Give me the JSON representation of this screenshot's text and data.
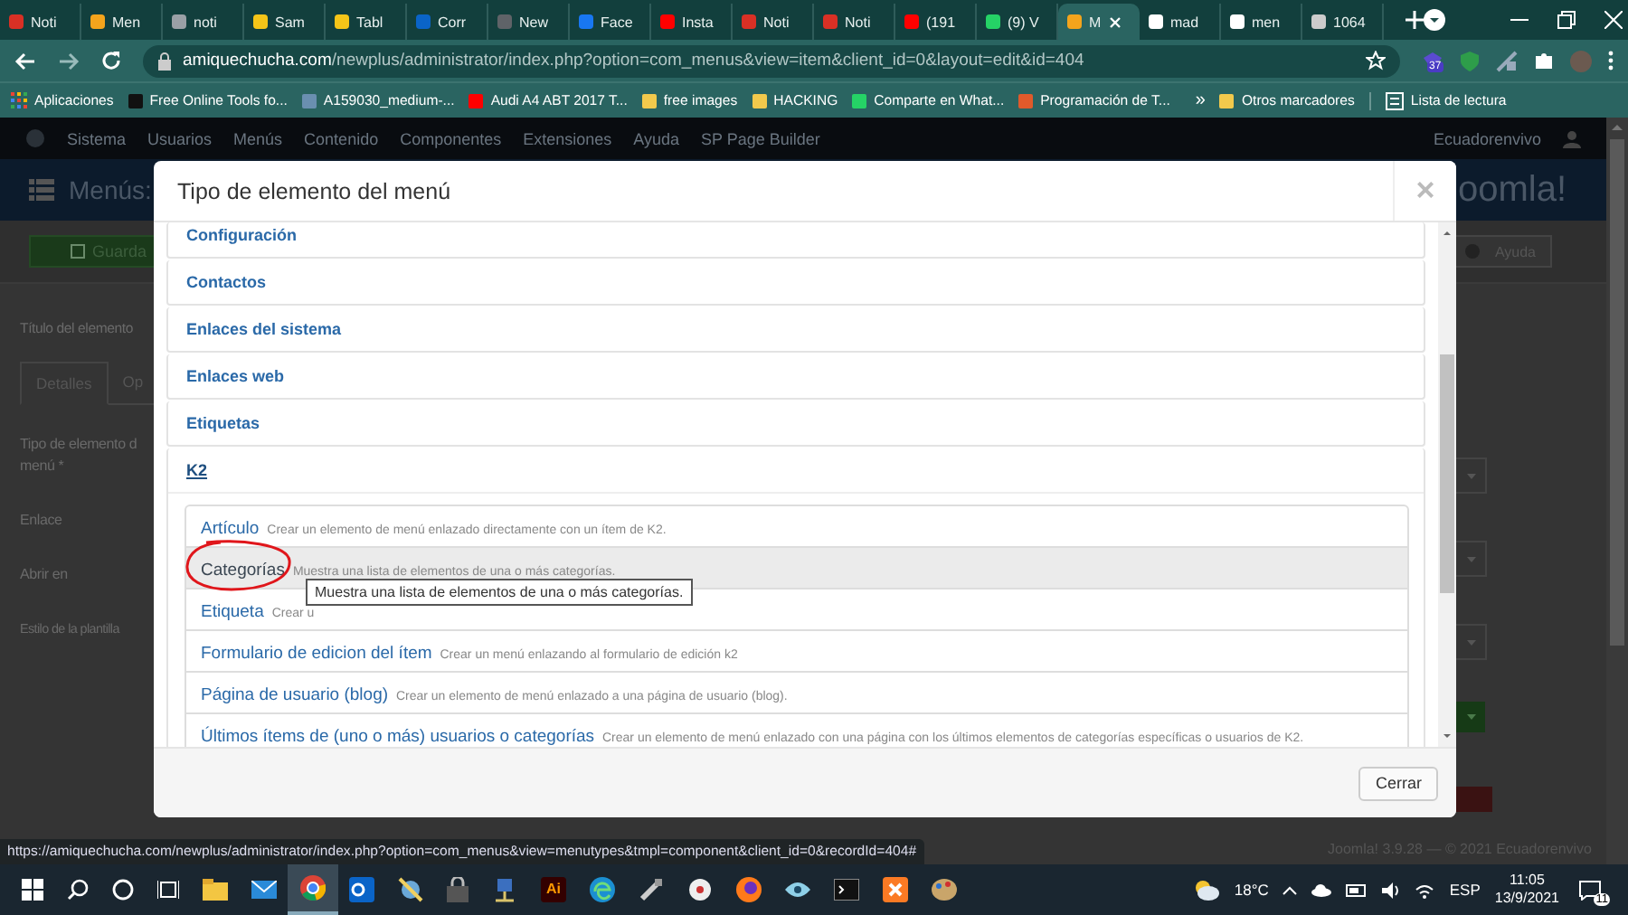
{
  "browser": {
    "tabs": [
      {
        "label": "Noti",
        "selected": false,
        "color": "#d93025"
      },
      {
        "label": "Men",
        "selected": false,
        "color": "#f4a41c"
      },
      {
        "label": "noti",
        "selected": false,
        "color": "#9aa0a6"
      },
      {
        "label": "Sam",
        "selected": false,
        "color": "#f5c518"
      },
      {
        "label": "Tabl",
        "selected": false,
        "color": "#f5c518"
      },
      {
        "label": "Corr",
        "selected": false,
        "color": "#0a64c8"
      },
      {
        "label": "New",
        "selected": false,
        "color": "#5f6368"
      },
      {
        "label": "Face",
        "selected": false,
        "color": "#1877f2"
      },
      {
        "label": "Insta",
        "selected": false,
        "color": "#ff0000"
      },
      {
        "label": "Noti",
        "selected": false,
        "color": "#d93025"
      },
      {
        "label": "Noti",
        "selected": false,
        "color": "#d93025"
      },
      {
        "label": "(191",
        "selected": false,
        "color": "#ff0000"
      },
      {
        "label": "(9) V",
        "selected": false,
        "color": "#25d366"
      },
      {
        "label": "M",
        "selected": true,
        "color": "#f4a41c"
      },
      {
        "label": "mad",
        "selected": false,
        "color": "#ffffff"
      },
      {
        "label": "men",
        "selected": false,
        "color": "#ffffff"
      },
      {
        "label": "1064",
        "selected": false,
        "color": "#cccccc"
      }
    ],
    "address": {
      "domain": "amiquechucha.com",
      "path": "/newplus/administrator/index.php?option=com_menus&view=item&client_id=0&layout=edit&id=404"
    },
    "extension_badge": "37",
    "bookmarks": [
      "Aplicaciones",
      "Free Online Tools fo...",
      "A159030_medium-...",
      "Audi A4 ABT 2017 T...",
      "free images",
      "HACKING",
      "Comparte en What...",
      "Programación de T..."
    ],
    "bookmarks_more": "»",
    "other_bookmarks": "Otros marcadores",
    "reading_list": "Lista de lectura"
  },
  "admin": {
    "nav": [
      "Sistema",
      "Usuarios",
      "Menús",
      "Contenido",
      "Componentes",
      "Extensiones",
      "Ayuda",
      "SP Page Builder"
    ],
    "site_link": "Ecuadorenvivo",
    "page_title": "Menús:",
    "logo": "oomla!",
    "save_button": "Guarda",
    "help_button": "Ayuda",
    "title_label": "Título del elemento",
    "form_tabs": [
      {
        "label": "Detalles",
        "selected": true
      },
      {
        "label": "Op",
        "selected": false
      }
    ],
    "field_labels": [
      [
        "Tipo de elemento d",
        "menú *"
      ],
      [
        "Enlace"
      ],
      [
        "Abrir en"
      ],
      [
        "Estilo de la plantilla"
      ]
    ],
    "footer": "Joomla! 3.9.28 — © 2021 Ecuadorenvivo"
  },
  "modal": {
    "title": "Tipo de elemento del menú",
    "close": "×",
    "sections": [
      {
        "label": "Configuración",
        "expanded": false
      },
      {
        "label": "Contactos",
        "expanded": false
      },
      {
        "label": "Enlaces del sistema",
        "expanded": false
      },
      {
        "label": "Enlaces web",
        "expanded": false
      },
      {
        "label": "Etiquetas",
        "expanded": false
      },
      {
        "label": "K2",
        "expanded": true,
        "items": [
          {
            "title": "Artículo",
            "description": "Crear un elemento de menú enlazado directamente con un ítem de K2.",
            "selected": false
          },
          {
            "title": "Categorías",
            "description": "Muestra una lista de elementos de una o más categorías.",
            "selected": true
          },
          {
            "title": "Etiqueta",
            "description": "Crear u",
            "selected": false
          },
          {
            "title": "Formulario de edicion del ítem",
            "description": "Crear un menú enlazando al formulario de edición k2",
            "selected": false
          },
          {
            "title": "Página de usuario (blog)",
            "description": "Crear un elemento de menú enlazado a una página de usuario (blog).",
            "selected": false
          },
          {
            "title": "Últimos ítems de (uno o más) usuarios o categorías",
            "description": "Crear un elemento de menú enlazado con una página con los últimos elementos de categorías específicas o usuarios de K2.",
            "selected": false
          }
        ]
      }
    ],
    "tooltip": "Muestra una lista de elementos de una o más categorías.",
    "close_button": "Cerrar"
  },
  "status_url": "https://amiquechucha.com/newplus/administrator/index.php?option=com_menus&view=menutypes&tmpl=component&client_id=0&recordId=404#",
  "taskbar": {
    "app_label": "Ai",
    "temperature": "18°C",
    "language": "ESP",
    "time": "11:05",
    "date": "13/9/2021",
    "notifications": "11"
  }
}
